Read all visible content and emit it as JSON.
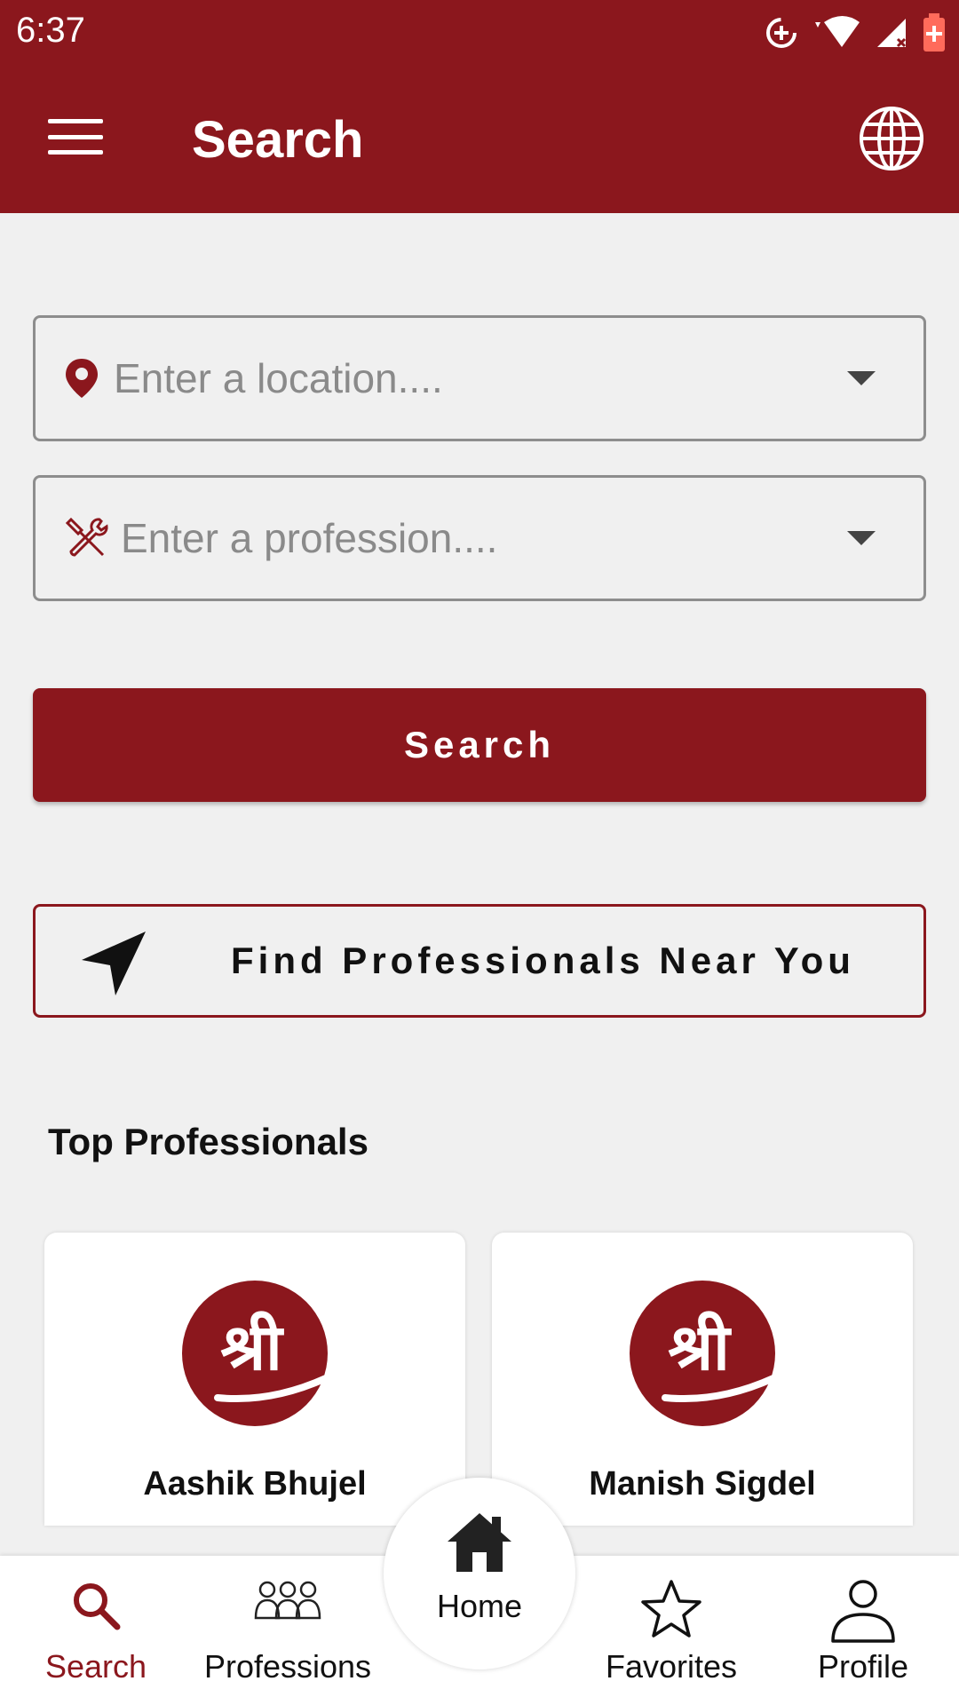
{
  "status_bar": {
    "time": "6:37"
  },
  "app_bar": {
    "title": "Search"
  },
  "location_field": {
    "placeholder": "Enter a location...."
  },
  "profession_field": {
    "placeholder": "Enter a profession...."
  },
  "search_button": {
    "label": "Search"
  },
  "near_button": {
    "label": "Find Professionals Near You"
  },
  "top_professionals": {
    "title": "Top Professionals",
    "items": [
      {
        "name": "Aashik Bhujel",
        "logo_text": "श्री"
      },
      {
        "name": "Manish Sigdel",
        "logo_text": "श्री"
      }
    ]
  },
  "bottom_nav": {
    "items": [
      {
        "label": "Search",
        "icon": "search-icon",
        "active": true
      },
      {
        "label": "Professions",
        "icon": "people-icon",
        "active": false
      },
      {
        "label": "Home",
        "icon": "home-icon",
        "active": false
      },
      {
        "label": "Favorites",
        "icon": "star-icon",
        "active": false
      },
      {
        "label": "Profile",
        "icon": "person-icon",
        "active": false
      }
    ]
  },
  "colors": {
    "brand": "#8b171d",
    "background": "#f0f0f0",
    "surface": "#ffffff"
  }
}
